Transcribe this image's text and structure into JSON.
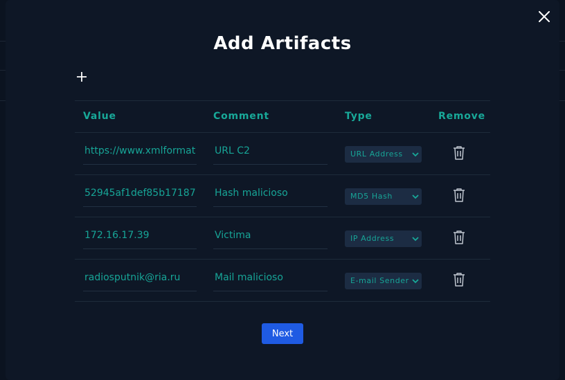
{
  "modal": {
    "title": "Add Artifacts",
    "next_label": "Next"
  },
  "table": {
    "headers": {
      "value": "Value",
      "comment": "Comment",
      "type": "Type",
      "remove": "Remove"
    },
    "rows": [
      {
        "value": "https://www.xmlformat",
        "comment": "URL C2",
        "type": "URL Address"
      },
      {
        "value": "52945af1def85b17187",
        "comment": "Hash malicioso",
        "type": "MD5 Hash"
      },
      {
        "value": "172.16.17.39",
        "comment": "Victima",
        "type": "IP Address"
      },
      {
        "value": " radiosputnik@ria.ru",
        "comment": "Mail malicioso",
        "type": "E-mail Sender"
      }
    ]
  },
  "colors": {
    "accent": "#18a999",
    "button": "#1f5be3",
    "modal_bg": "#0e1726"
  },
  "icons": [
    "close-icon",
    "plus-icon",
    "chevron-down-icon",
    "trash-icon"
  ]
}
